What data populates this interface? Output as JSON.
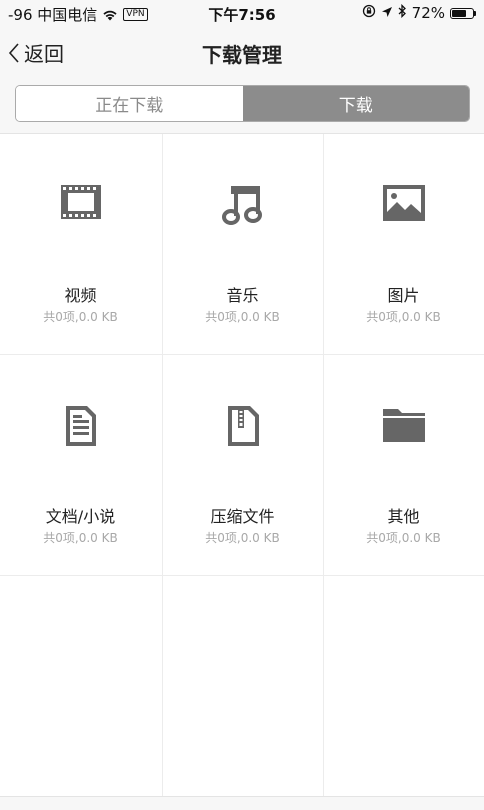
{
  "status_bar": {
    "carrier": "-96 中国电信",
    "vpn": "VPN",
    "time": "下午7:56",
    "battery_percent": "72%",
    "battery_level": 0.72
  },
  "nav": {
    "back_label": "返回",
    "title": "下载管理"
  },
  "segments": {
    "downloading": "正在下载",
    "downloaded": "下载",
    "active": "downloaded"
  },
  "categories": [
    {
      "name": "视频",
      "summary": "共0项,0.0 KB",
      "icon": "video-icon"
    },
    {
      "name": "音乐",
      "summary": "共0项,0.0 KB",
      "icon": "music-icon"
    },
    {
      "name": "图片",
      "summary": "共0项,0.0 KB",
      "icon": "image-icon"
    },
    {
      "name": "文档/小说",
      "summary": "共0项,0.0 KB",
      "icon": "document-icon"
    },
    {
      "name": "压缩文件",
      "summary": "共0项,0.0 KB",
      "icon": "archive-icon"
    },
    {
      "name": "其他",
      "summary": "共0项,0.0 KB",
      "icon": "folder-icon"
    }
  ],
  "colors": {
    "icon": "#666666",
    "segment_active_bg": "#8c8c8c",
    "subtext": "#a8a8a8"
  }
}
